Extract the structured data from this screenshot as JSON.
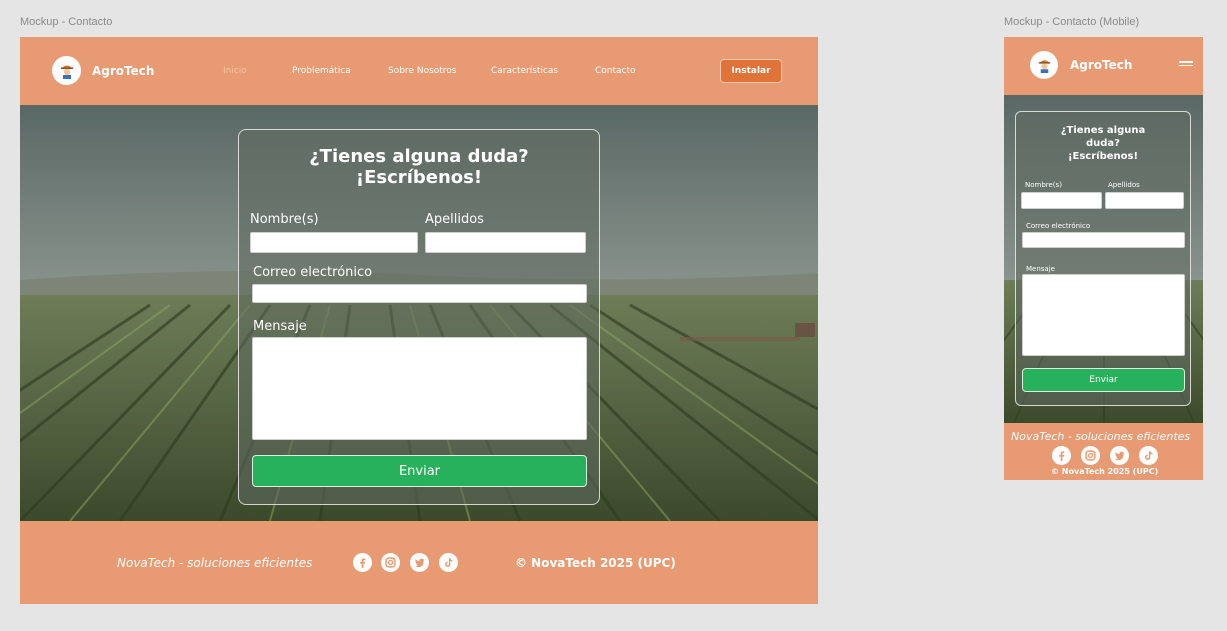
{
  "frames": {
    "desktop_label": "Mockup - Contacto",
    "mobile_label": "Mockup - Contacto (Mobile)"
  },
  "brand": {
    "name": "AgroTech"
  },
  "nav": {
    "items": [
      {
        "label": "Inicio",
        "active": true
      },
      {
        "label": "Problemática",
        "active": false
      },
      {
        "label": "Sobre Nosotros",
        "active": false
      },
      {
        "label": "Características",
        "active": false
      },
      {
        "label": "Contacto",
        "active": false
      }
    ],
    "install_label": "Instalar"
  },
  "form": {
    "title_line1": "¿Tienes alguna duda?",
    "title_line2": "¡Escríbenos!",
    "mobile_title_line1": "¿Tienes alguna",
    "mobile_title_line2": "duda?",
    "mobile_title_line3": "¡Escríbenos!",
    "first_name_label": "Nombre(s)",
    "last_name_label": "Apellidos",
    "email_label": "Correo electrónico",
    "message_label": "Mensaje",
    "submit_label": "Enviar",
    "first_name_value": "",
    "last_name_value": "",
    "email_value": "",
    "message_value": ""
  },
  "footer": {
    "tagline": "NovaTech - soluciones eficientes",
    "copyright": "© NovaTech 2025 (UPC)",
    "social": [
      "facebook-icon",
      "instagram-icon",
      "twitter-icon",
      "tiktok-icon"
    ]
  },
  "colors": {
    "primary": "#e89a72",
    "install_button": "#e0733a",
    "submit_button": "#27b15d"
  }
}
